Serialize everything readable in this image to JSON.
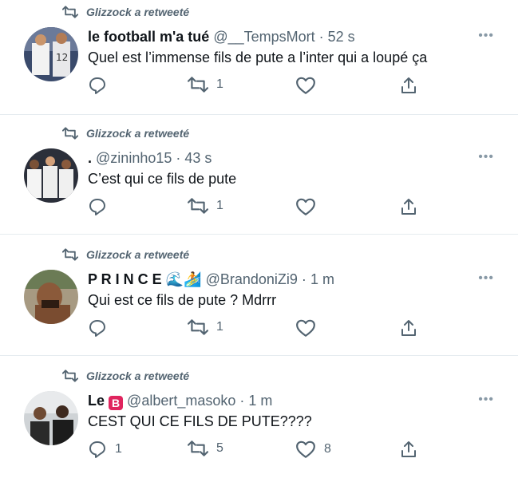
{
  "colors": {
    "text_primary": "#0f1419",
    "text_secondary": "#536471",
    "divider": "#e6ecf0"
  },
  "tweets": [
    {
      "retweeted_by": "Glizzock a retweeté",
      "name": "le football m'a tué",
      "handle": "@__TempsMort",
      "dot": "·",
      "time": "52 s",
      "text": "Quel est l’immense fils de pute a l’inter qui a loupé ça",
      "reply_count": "",
      "retweet_count": "1",
      "like_count": "",
      "avatar_icon": "avatar-football-player"
    },
    {
      "retweeted_by": "Glizzock a retweeté",
      "name": ".",
      "handle": "@zininho15",
      "dot": "·",
      "time": "43 s",
      "text": "C’est qui ce fils de pute",
      "reply_count": "",
      "retweet_count": "1",
      "like_count": "",
      "avatar_icon": "avatar-team-photo"
    },
    {
      "retweeted_by": "Glizzock a retweeté",
      "name": "P R I N C E",
      "name_emoji": "🌊🏄",
      "handle": "@BrandoniZi9",
      "dot": "·",
      "time": "1 m",
      "text": "Qui est ce fils de pute ? Mdrrr",
      "reply_count": "",
      "retweet_count": "1",
      "like_count": "",
      "avatar_icon": "avatar-person"
    },
    {
      "retweeted_by": "Glizzock a retweeté",
      "name": "Le",
      "name_emoji": "B",
      "handle": "@albert_masoko",
      "dot": "·",
      "time": "1 m",
      "text": "CEST QUI CE FILS DE PUTE????",
      "reply_count": "1",
      "retweet_count": "5",
      "like_count": "8",
      "avatar_icon": "avatar-two-people"
    }
  ]
}
